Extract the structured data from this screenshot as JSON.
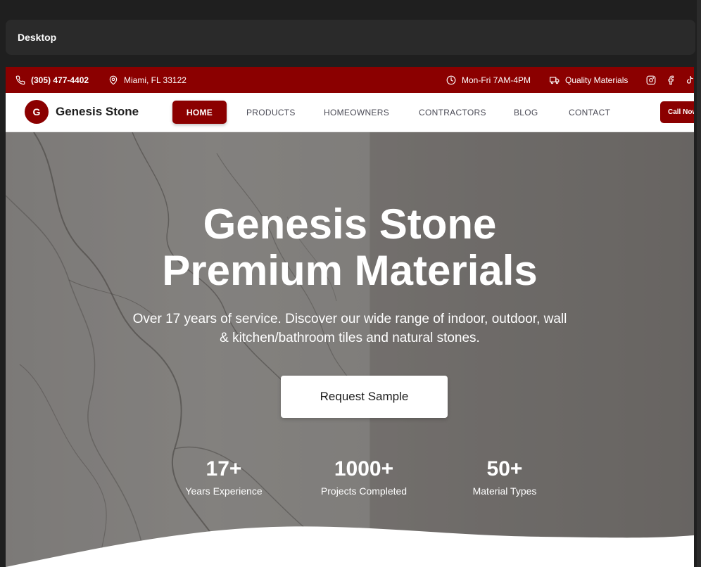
{
  "window": {
    "title": "Desktop"
  },
  "topbar": {
    "phone": "(305) 477-4402",
    "location": "Miami, FL 33122",
    "hours": "Mon-Fri 7AM-4PM",
    "quality": "Quality Materials",
    "social_icons": [
      "instagram-icon",
      "facebook-icon",
      "tiktok-icon"
    ]
  },
  "nav": {
    "logo_letter": "G",
    "brand": "Genesis Stone",
    "links": [
      "HOME",
      "PRODUCTS",
      "HOMEOWNERS",
      "CONTRACTORS",
      "BLOG",
      "CONTACT"
    ],
    "active": "HOME",
    "call_button": "Call Now"
  },
  "hero": {
    "title_line1": "Genesis Stone",
    "title_line2": "Premium Materials",
    "subtitle": "Over 17 years of service. Discover our wide range of indoor, outdoor, wall & kitchen/bathroom tiles and natural stones.",
    "cta": "Request Sample",
    "stats": [
      {
        "value": "17+",
        "label": "Years Experience"
      },
      {
        "value": "1000+",
        "label": "Projects Completed"
      },
      {
        "value": "50+",
        "label": "Material Types"
      }
    ]
  },
  "colors": {
    "brand": "#8b0000",
    "window_bg": "#1f1f1f",
    "panel_bg": "#2a2a2a"
  }
}
